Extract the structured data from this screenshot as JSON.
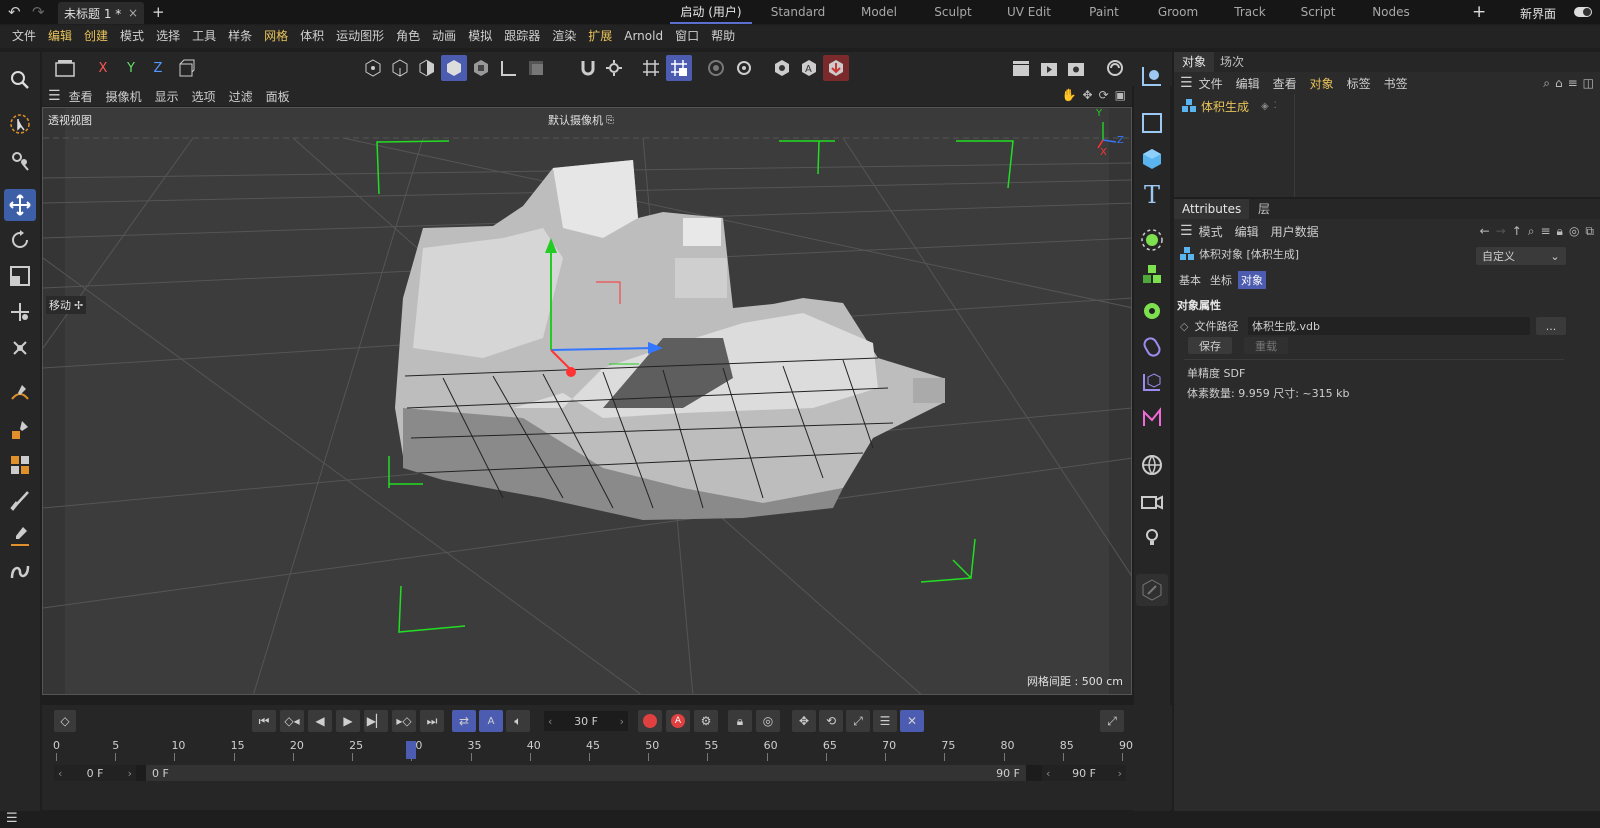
{
  "titlebar": {
    "doc_tab": "未标题 1 *",
    "close": "×",
    "plus": "+",
    "layouts": [
      "启动 (用户)",
      "Standard",
      "Model",
      "Sculpt",
      "UV Edit",
      "Paint",
      "Groom",
      "Track",
      "Script",
      "Nodes"
    ],
    "active_layout": "启动 (用户)",
    "new_ui": "新界面"
  },
  "menubar": [
    "文件",
    "编辑",
    "创建",
    "模式",
    "选择",
    "工具",
    "样条",
    "网格",
    "体积",
    "运动图形",
    "角色",
    "动画",
    "模拟",
    "跟踪器",
    "渲染",
    "扩展",
    "Arnold",
    "窗口",
    "帮助"
  ],
  "menubar_highlight": [
    "编辑",
    "创建",
    "网格",
    "扩展"
  ],
  "axis_buttons": [
    "X",
    "Y",
    "Z"
  ],
  "viewport_menu": [
    "查看",
    "摄像机",
    "显示",
    "选项",
    "过滤",
    "面板"
  ],
  "viewport": {
    "view_name": "透视视图",
    "camera_name": "默认摄像机",
    "move_label": "移动",
    "grid_spacing": "网格间距 : 500 cm",
    "axis_x": "X",
    "axis_y": "Y",
    "axis_z": "Z"
  },
  "object_panel": {
    "tabs": [
      "对象",
      "场次"
    ],
    "menu": [
      "文件",
      "编辑",
      "查看",
      "对象",
      "标签",
      "书签"
    ],
    "menu_active": "对象",
    "object_name": "体积生成"
  },
  "attributes": {
    "tabs": [
      "Attributes",
      "层"
    ],
    "menu": [
      "模式",
      "编辑",
      "用户数据"
    ],
    "object_title": "体积对象 [体积生成]",
    "preset": "自定义",
    "subtabs": [
      "基本",
      "坐标",
      "对象"
    ],
    "active_subtab": "对象",
    "section": "对象属性",
    "file_path_label": "文件路径",
    "file_path_value": "体积生成.vdb",
    "browse": "...",
    "save": "保存",
    "reload": "重载",
    "info1": "单精度 SDF",
    "info2": "体素数量: 9.959   尺寸: ~315 kb"
  },
  "timeline": {
    "current_frame": "30 F",
    "ruler": [
      "0",
      "5",
      "10",
      "15",
      "20",
      "25",
      "30",
      "35",
      "40",
      "45",
      "50",
      "55",
      "60",
      "65",
      "70",
      "75",
      "80",
      "85",
      "90"
    ],
    "playhead_frame": 30,
    "start_field": "0 F",
    "range_start": "0 F",
    "range_end": "90 F",
    "end_field": "90 F"
  },
  "colors": {
    "accent": "#4c5cb0",
    "highlight_text": "#e8c35a",
    "green_guides": "#22dd22"
  }
}
